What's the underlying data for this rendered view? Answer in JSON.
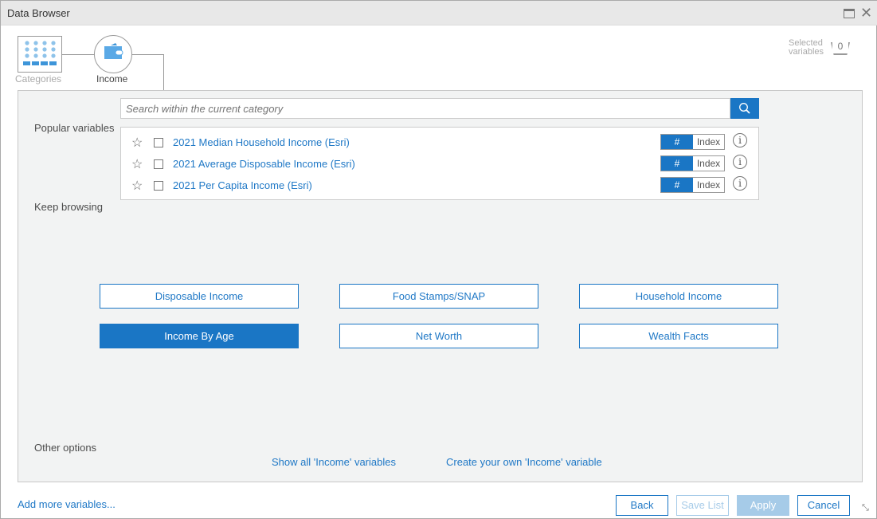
{
  "window": {
    "title": "Data Browser"
  },
  "breadcrumb": {
    "categories": "Categories",
    "income": "Income"
  },
  "selected": {
    "label_line1": "Selected",
    "label_line2": "variables",
    "count": "0"
  },
  "search": {
    "placeholder": "Search within the current category"
  },
  "sections": {
    "popular": "Popular variables",
    "keep_browsing": "Keep browsing",
    "other": "Other options"
  },
  "popular_variables": [
    {
      "label": "2021 Median Household Income (Esri)",
      "toggle_hash": "#",
      "toggle_index": "Index"
    },
    {
      "label": "2021 Average Disposable Income (Esri)",
      "toggle_hash": "#",
      "toggle_index": "Index"
    },
    {
      "label": "2021 Per Capita Income (Esri)",
      "toggle_hash": "#",
      "toggle_index": "Index"
    }
  ],
  "subcategories": [
    {
      "label": "Disposable Income",
      "selected": false
    },
    {
      "label": "Food Stamps/SNAP",
      "selected": false
    },
    {
      "label": "Household Income",
      "selected": false
    },
    {
      "label": "Income By Age",
      "selected": true
    },
    {
      "label": "Net Worth",
      "selected": false
    },
    {
      "label": "Wealth Facts",
      "selected": false
    }
  ],
  "other_links": {
    "show_all": "Show all 'Income' variables",
    "create": "Create your own 'Income' variable"
  },
  "footer": {
    "add_more": "Add more variables...",
    "back": "Back",
    "save_list": "Save List",
    "apply": "Apply",
    "cancel": "Cancel"
  },
  "colors": {
    "accent": "#1a76c5",
    "disabled": "#a6cbe8",
    "panel": "#f2f3f3"
  }
}
